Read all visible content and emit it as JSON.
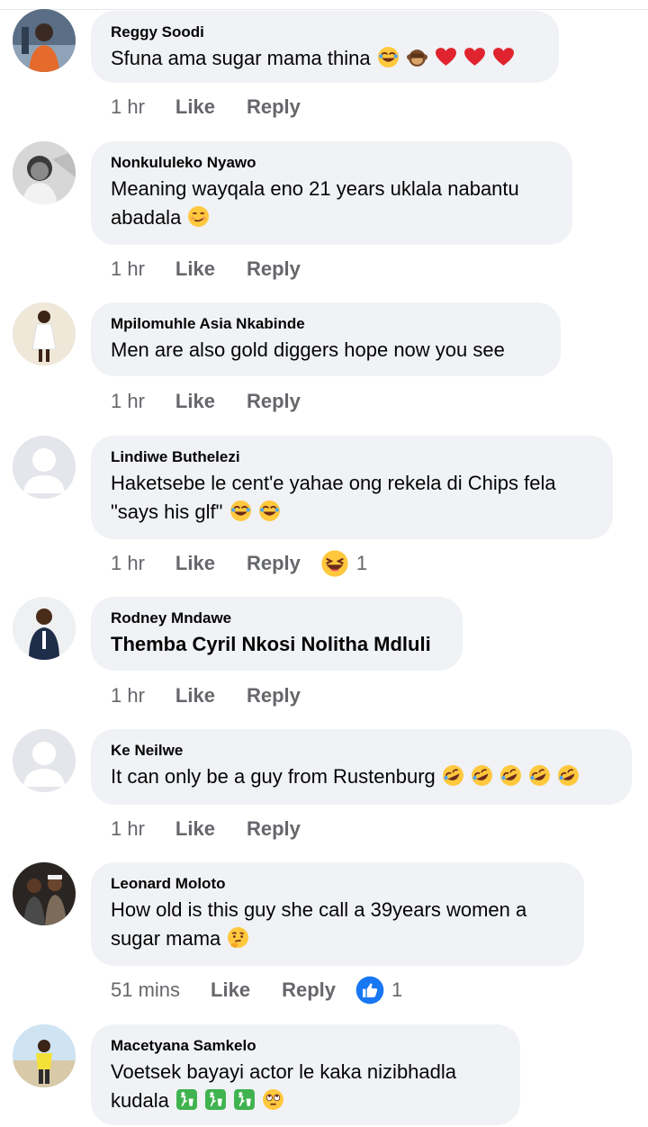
{
  "actions": {
    "like": "Like",
    "reply": "Reply"
  },
  "comments": [
    {
      "author": "Reggy Soodi",
      "text": "Sfuna ama sugar mama thina",
      "emojis": [
        "joy-emoji",
        "monkey-emoji",
        "heart-emoji",
        "heart-emoji",
        "heart-emoji"
      ],
      "time": "1 hr"
    },
    {
      "author": "Nonkululeko Nyawo",
      "text": "Meaning wayqala eno 21 years uklala nabantu abadala",
      "emojis": [
        "smirk-emoji"
      ],
      "time": "1 hr"
    },
    {
      "author": "Mpilomuhle Asia Nkabinde",
      "text": "Men are also gold diggers hope now you see",
      "emojis": [],
      "time": "1 hr"
    },
    {
      "author": "Lindiwe Buthelezi",
      "text": "Haketsebe le cent'e yahae ong rekela di Chips fela \"says his glf\"",
      "emojis": [
        "joy-emoji",
        "joy-emoji"
      ],
      "time": "1 hr",
      "reaction": {
        "icon": "haha-reaction-icon",
        "count": "1"
      }
    },
    {
      "author": "Rodney Mndawe",
      "text": "Themba Cyril Nkosi Nolitha Mdluli",
      "emojis": [],
      "time": "1 hr"
    },
    {
      "author": "Ke Neilwe",
      "text": "It can only be a guy from Rustenburg",
      "emojis": [
        "rofl-emoji",
        "rofl-emoji",
        "rofl-emoji",
        "rofl-emoji",
        "rofl-emoji"
      ],
      "time": "1 hr"
    },
    {
      "author": "Leonard Moloto",
      "text": "How old is this guy she call a 39years women a sugar mama",
      "emojis": [
        "thinking-emoji"
      ],
      "time": "51 mins",
      "reaction": {
        "icon": "like-reaction-icon",
        "count": "1"
      }
    },
    {
      "author": "Macetyana Samkelo",
      "text": "Voetsek bayayi actor  le kaka  nizibhadla kudala",
      "emojis": [
        "litter-emoji",
        "litter-emoji",
        "litter-emoji",
        "eyeroll-emoji"
      ],
      "time": ""
    }
  ]
}
